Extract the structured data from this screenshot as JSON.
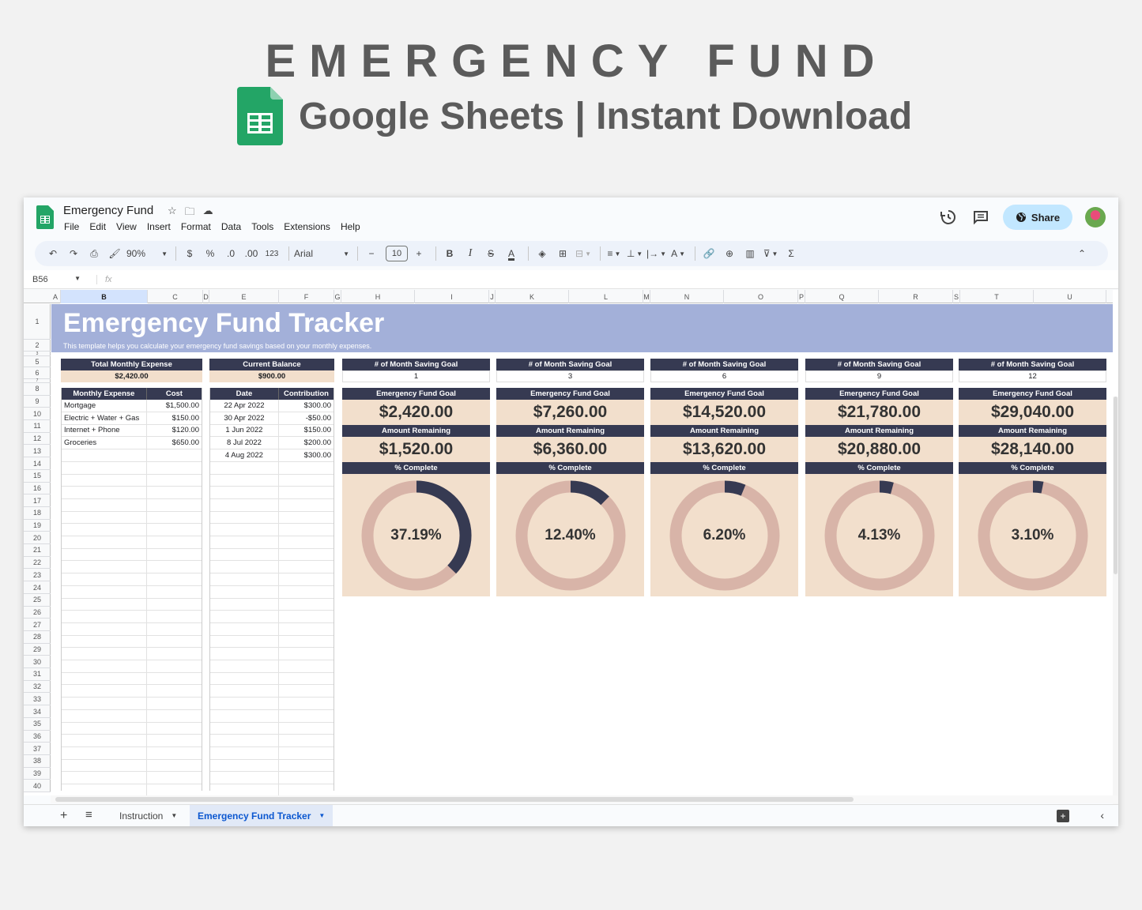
{
  "hero": {
    "title": "EMERGENCY FUND",
    "subtitle": "Google Sheets | Instant Download"
  },
  "app": {
    "doc_title": "Emergency Fund",
    "menu": [
      "File",
      "Edit",
      "View",
      "Insert",
      "Format",
      "Data",
      "Tools",
      "Extensions",
      "Help"
    ],
    "share_label": "Share",
    "icons": {
      "star": "star-icon",
      "move": "folder-move-icon",
      "cloud": "cloud-status-icon",
      "history": "history-icon",
      "comments": "comment-icon",
      "globe": "globe-icon"
    }
  },
  "toolbar": {
    "zoom": "90%",
    "currency": "$",
    "percent": "%",
    "dec_decrease": ".0",
    "dec_increase": ".00",
    "number_format": "123",
    "font": "Arial",
    "font_size": "10"
  },
  "formula_bar": {
    "name_box": "B56",
    "fx": "fx"
  },
  "columns": [
    "A",
    "B",
    "C",
    "D",
    "E",
    "F",
    "G",
    "H",
    "I",
    "J",
    "K",
    "L",
    "M",
    "N",
    "O",
    "P",
    "Q",
    "R",
    "S",
    "T",
    "U"
  ],
  "rows": [
    "1",
    "2",
    "3",
    "5",
    "6",
    "7",
    "8",
    "9",
    "10",
    "11",
    "12",
    "13",
    "14",
    "15",
    "16",
    "17",
    "18",
    "19",
    "20",
    "21",
    "22",
    "23",
    "24",
    "25",
    "26",
    "27",
    "28",
    "29",
    "30",
    "31",
    "32",
    "33",
    "34",
    "35",
    "36",
    "37",
    "38",
    "39",
    "40"
  ],
  "sheet": {
    "title": "Emergency Fund Tracker",
    "subtitle": "This template helps you calculate your emergency fund savings based on your monthly expenses.",
    "total_monthly_expense": {
      "label": "Total Monthly Expense",
      "value": "$2,420.00"
    },
    "current_balance": {
      "label": "Current Balance",
      "value": "$900.00"
    },
    "expenses": {
      "headers": [
        "Monthly Expense",
        "Cost"
      ],
      "rows": [
        [
          "Mortgage",
          "$1,500.00"
        ],
        [
          "Electric + Water + Gas",
          "$150.00"
        ],
        [
          "Internet + Phone",
          "$120.00"
        ],
        [
          "Groceries",
          "$650.00"
        ]
      ]
    },
    "contributions": {
      "headers": [
        "Date",
        "Contribution"
      ],
      "rows": [
        [
          "22 Apr 2022",
          "$300.00"
        ],
        [
          "30 Apr 2022",
          "-$50.00"
        ],
        [
          "1 Jun 2022",
          "$150.00"
        ],
        [
          "8 Jul 2022",
          "$200.00"
        ],
        [
          "4 Aug 2022",
          "$300.00"
        ]
      ]
    },
    "card_labels": {
      "months": "# of Month Saving Goal",
      "goal": "Emergency Fund Goal",
      "remaining": "Amount Remaining",
      "complete": "% Complete"
    },
    "cards": [
      {
        "months": "1",
        "goal": "$2,420.00",
        "remaining": "$1,520.00",
        "percent_label": "37.19%",
        "percent": 37.19
      },
      {
        "months": "3",
        "goal": "$7,260.00",
        "remaining": "$6,360.00",
        "percent_label": "12.40%",
        "percent": 12.4
      },
      {
        "months": "6",
        "goal": "$14,520.00",
        "remaining": "$13,620.00",
        "percent_label": "6.20%",
        "percent": 6.2
      },
      {
        "months": "9",
        "goal": "$21,780.00",
        "remaining": "$20,880.00",
        "percent_label": "4.13%",
        "percent": 4.13
      },
      {
        "months": "12",
        "goal": "$29,040.00",
        "remaining": "$28,140.00",
        "percent_label": "3.10%",
        "percent": 3.1
      }
    ]
  },
  "colors": {
    "header_dark": "#363a52",
    "peach": "#f2dfcc",
    "donut_track": "#d8b4a8",
    "banner": "#a3b0d9",
    "share_bg": "#c2e7ff"
  },
  "tabs": [
    {
      "label": "Instruction",
      "active": false
    },
    {
      "label": "Emergency Fund Tracker",
      "active": true
    }
  ]
}
